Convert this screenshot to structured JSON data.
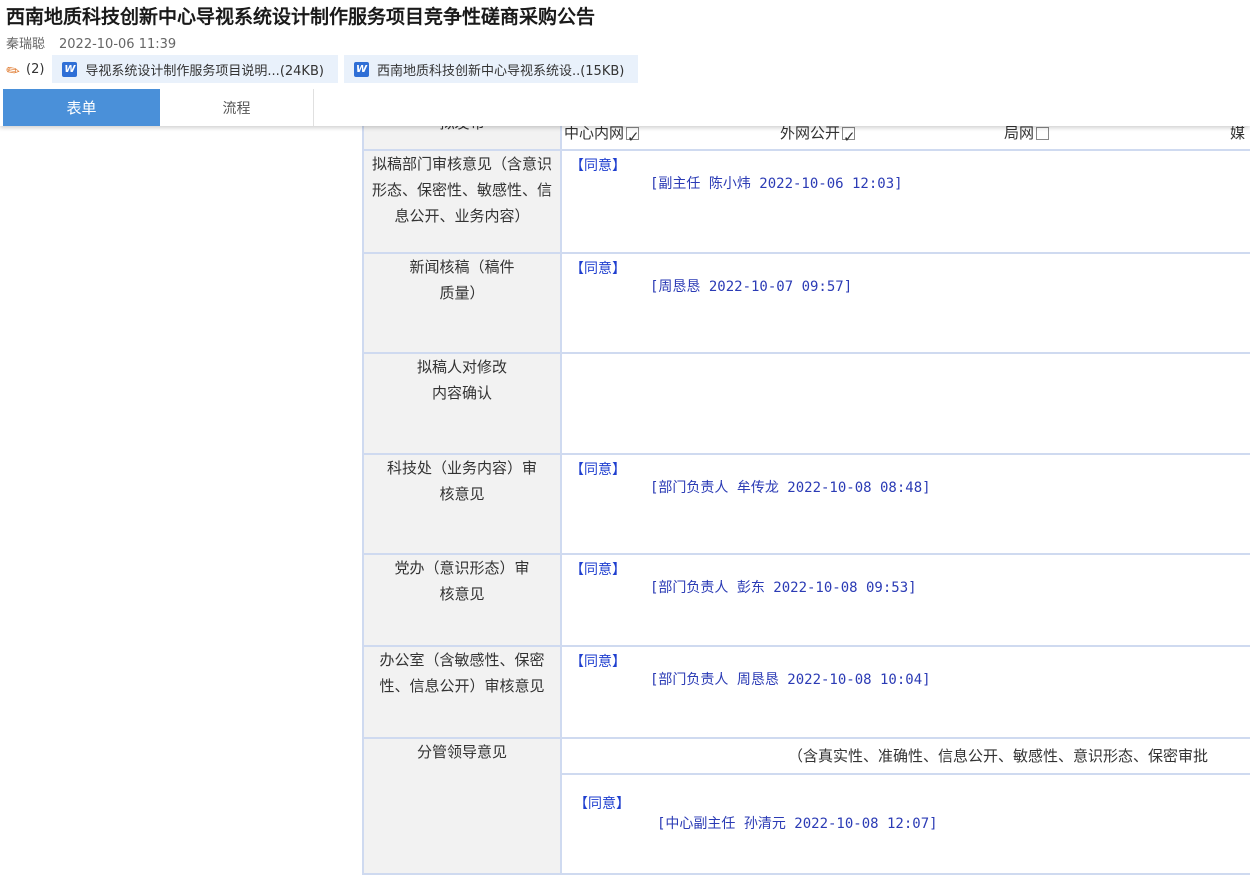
{
  "header": {
    "title": "西南地质科技创新中心导视系统设计制作服务项目竞争性磋商采购公告",
    "author": "秦瑞聪",
    "datetime": "2022-10-06 11:39"
  },
  "attachments": {
    "count": "(2)",
    "files": [
      {
        "name": "导视系统设计制作服务项目说明...(24KB)",
        "icon": "word-icon"
      },
      {
        "name": "西南地质科技创新中心导视系统设..(15KB)",
        "icon": "word-icon"
      }
    ]
  },
  "tabs": [
    {
      "label": "表单",
      "active": true
    },
    {
      "label": "流程",
      "active": false
    }
  ],
  "form": {
    "scope_row": {
      "label": "拟发布",
      "options": [
        "中心内网",
        "外网公开",
        "局网",
        "媒"
      ]
    },
    "rows": [
      {
        "label": "拟稿部门审核意见（含意识形态、保密性、敏感性、信息公开、业务内容）",
        "opinion": "【同意】",
        "sign": "[副主任 陈小炜 2022-10-06 12:03]"
      },
      {
        "label": "新闻核稿（稿件质量）",
        "opinion": "【同意】",
        "sign": "[周恳恳 2022-10-07 09:57]"
      },
      {
        "label": "拟稿人对修改内容确认",
        "opinion": "",
        "sign": ""
      },
      {
        "label": "科技处（业务内容）审核意见",
        "opinion": "【同意】",
        "sign": "[部门负责人 牟传龙 2022-10-08 08:48]"
      },
      {
        "label": "党办（意识形态）审核意见",
        "opinion": "【同意】",
        "sign": "[部门负责人 彭东 2022-10-08 09:53]"
      },
      {
        "label": "办公室（含敏感性、保密性、信息公开）审核意见",
        "opinion": "【同意】",
        "sign": "[部门负责人 周恳恳 2022-10-08 10:04]"
      }
    ],
    "leader": {
      "label": "分管领导意见",
      "note": "（含真实性、准确性、信息公开、敏感性、意识形态、保密审批",
      "opinion": "【同意】",
      "sign": "[中心副主任 孙清元 2022-10-08 12:07]"
    }
  }
}
